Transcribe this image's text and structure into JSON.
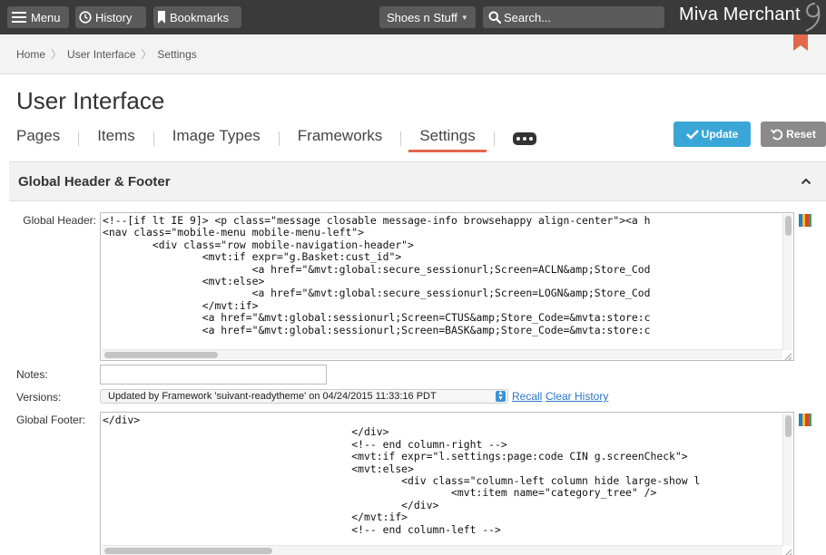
{
  "topbar": {
    "menu_label": "Menu",
    "history_label": "History",
    "bookmarks_label": "Bookmarks",
    "store_selected": "Shoes n Stuff",
    "search_placeholder": "Search...",
    "brand": "Miva Merchant"
  },
  "breadcrumb": [
    "Home",
    "User Interface",
    "Settings"
  ],
  "page_title": "User Interface",
  "tabs": [
    "Pages",
    "Items",
    "Image Types",
    "Frameworks",
    "Settings"
  ],
  "active_tab": "Settings",
  "actions": {
    "update_label": "Update",
    "reset_label": "Reset"
  },
  "panel": {
    "title": "Global Header & Footer",
    "header_label": "Global Header:",
    "header_code": "<!--[if lt IE 9]> <p class=\"message closable message-info browsehappy align-center\"><a h\n<nav class=\"mobile-menu mobile-menu-left\">\n        <div class=\"row mobile-navigation-header\">\n                <mvt:if expr=\"g.Basket:cust_id\">\n                        <a href=\"&mvt:global:secure_sessionurl;Screen=ACLN&amp;Store_Cod\n                <mvt:else>\n                        <a href=\"&mvt:global:secure_sessionurl;Screen=LOGN&amp;Store_Cod\n                </mvt:if>\n                <a href=\"&mvt:global:sessionurl;Screen=CTUS&amp;Store_Code=&mvta:store:c\n                <a href=\"&mvt:global:sessionurl;Screen=BASK&amp;Store_Code=&mvta:store:c",
    "notes_label": "Notes:",
    "notes_value": "",
    "versions_label": "Versions:",
    "versions_selected": "Updated by Framework 'suivant-readytheme' on 04/24/2015 11:33:16 PDT",
    "recall_label": "Recall",
    "clear_history_label": "Clear History",
    "footer_label": "Global Footer:",
    "footer_code": "</div>\n                                        </div>\n                                        <!-- end column-right -->\n                                        <mvt:if expr=\"l.settings:page:code CIN g.screenCheck\">\n                                        <mvt:else>\n                                                <div class=\"column-left column hide large-show l\n                                                        <mvt:item name=\"category_tree\" />\n                                                </div>\n                                        </mvt:if>\n                                        <!-- end column-left -->"
  },
  "colors": {
    "topbar": "#3a3a3a",
    "accent": "#e2684b",
    "update": "#3aa6d8",
    "reset": "#8a8a8a",
    "link": "#2a75c6"
  },
  "icons": [
    "hamburger-icon",
    "clock-icon",
    "bookmark-icon",
    "search-icon",
    "checkmark-icon",
    "reset-arrow-icon",
    "chevron-up-icon",
    "color-bars-icon"
  ]
}
